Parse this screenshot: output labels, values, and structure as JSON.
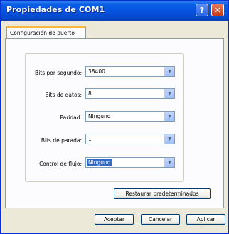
{
  "window": {
    "title": "Propiedades de COM1"
  },
  "titlebar_buttons": {
    "help": "?",
    "close": "✕"
  },
  "tab": {
    "label": "Configuración de puerto"
  },
  "fields": [
    {
      "label": "Bits por segundo:",
      "value": "38400"
    },
    {
      "label": "Bits de datos:",
      "value": "8"
    },
    {
      "label": "Paridad:",
      "value": "Ninguno"
    },
    {
      "label": "Bits de parada:",
      "value": "1"
    },
    {
      "label": "Control de flujo:",
      "value": "Ninguno"
    }
  ],
  "buttons": {
    "restore": "Restaurar predeterminados",
    "ok": "Aceptar",
    "cancel": "Cancelar",
    "apply": "Aplicar"
  },
  "dropdown_glyph": "▼"
}
